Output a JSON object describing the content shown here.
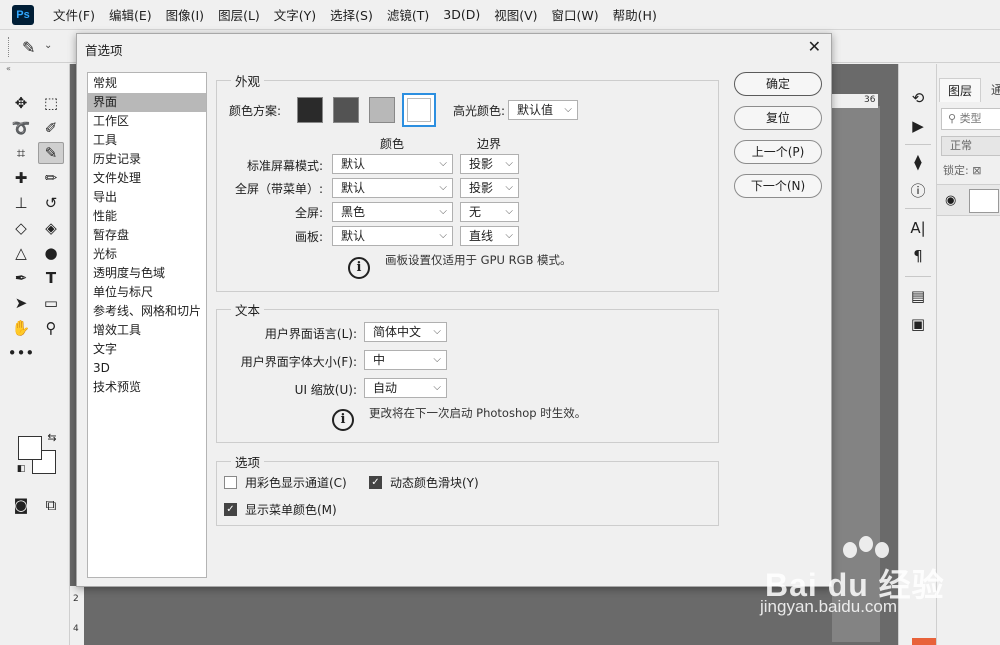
{
  "app": {
    "logo": "Ps"
  },
  "menu": [
    "文件(F)",
    "编辑(E)",
    "图像(I)",
    "图层(L)",
    "文字(Y)",
    "选择(S)",
    "滤镜(T)",
    "3D(D)",
    "视图(V)",
    "窗口(W)",
    "帮助(H)"
  ],
  "ruler": {
    "top_label": "36",
    "left_labels": [
      "2",
      "4"
    ]
  },
  "layers_panel": {
    "tabs": [
      "图层",
      "通"
    ],
    "search_placeholder": "类型",
    "blend_mode": "正常",
    "lock_label": "锁定:"
  },
  "dialog": {
    "title": "首选项",
    "categories": [
      "常规",
      "界面",
      "工作区",
      "工具",
      "历史记录",
      "文件处理",
      "导出",
      "性能",
      "暂存盘",
      "光标",
      "透明度与色域",
      "单位与标尺",
      "参考线、网格和切片",
      "增效工具",
      "文字",
      "3D",
      "技术预览"
    ],
    "selected_category": "界面",
    "appearance": {
      "title": "外观",
      "color_scheme_label": "颜色方案:",
      "scheme_colors": [
        "#2a2a2a",
        "#535353",
        "#b8b8b8",
        "#f0f0f0"
      ],
      "highlight_label": "高光颜色:",
      "highlight_value": "默认值",
      "col_color": "颜色",
      "col_border": "边界",
      "rows": [
        {
          "label": "标准屏幕模式:",
          "color": "默认",
          "border": "投影"
        },
        {
          "label": "全屏（带菜单）:",
          "color": "默认",
          "border": "投影"
        },
        {
          "label": "全屏:",
          "color": "黑色",
          "border": "无"
        },
        {
          "label": "画板:",
          "color": "默认",
          "border": "直线"
        }
      ],
      "note": "画板设置仅适用于 GPU RGB 模式。"
    },
    "text": {
      "title": "文本",
      "language_label": "用户界面语言(L):",
      "language_value": "简体中文",
      "font_size_label": "用户界面字体大小(F):",
      "font_size_value": "中",
      "scale_label": "UI 缩放(U):",
      "scale_value": "自动",
      "note": "更改将在下一次启动 Photoshop 时生效。"
    },
    "options": {
      "title": "选项",
      "channels_label": "用彩色显示通道(C)",
      "channels_checked": false,
      "dynamic_label": "动态颜色滑块(Y)",
      "dynamic_checked": true,
      "menu_color_label": "显示菜单颜色(M)",
      "menu_color_checked": true
    },
    "buttons": {
      "ok": "确定",
      "reset": "复位",
      "prev": "上一个(P)",
      "next": "下一个(N)"
    }
  },
  "watermark": {
    "logo": "Bai du 经验",
    "url": "jingyan.baidu.com"
  }
}
